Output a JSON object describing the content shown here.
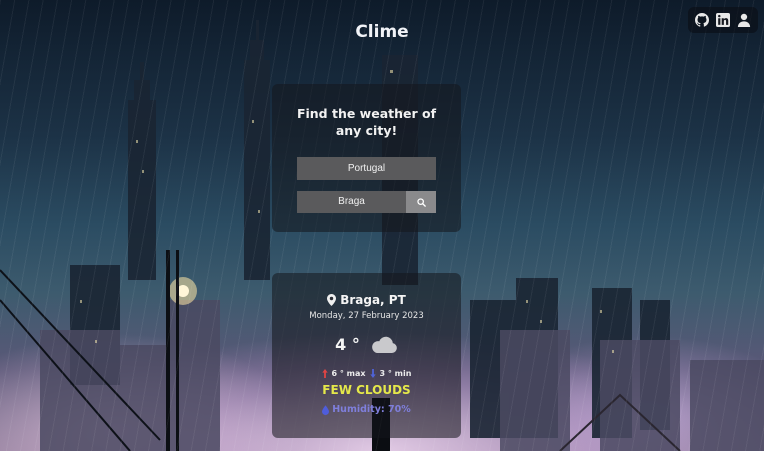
{
  "app": {
    "title": "Clime"
  },
  "social": {
    "items": [
      {
        "icon": "github-icon"
      },
      {
        "icon": "linkedin-icon"
      },
      {
        "icon": "user-icon"
      }
    ]
  },
  "search": {
    "heading": "Find the weather of any city!",
    "country_value": "Portugal",
    "city_value": "Braga",
    "search_icon": "search-icon"
  },
  "weather": {
    "location": "Braga, PT",
    "date": "Monday, 27 February 2023",
    "temp": "4 °",
    "max": "6 ° max",
    "min": "3 ° min",
    "condition": "FEW CLOUDS",
    "humidity": "Humidity: 70%",
    "condition_color": "#e5e84a",
    "humidity_color": "#7f7fdc"
  }
}
